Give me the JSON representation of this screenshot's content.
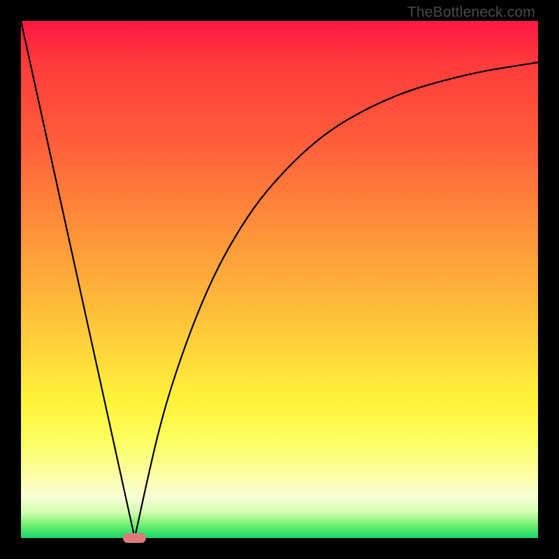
{
  "watermark_text": "TheBottleneck.com",
  "chart_data": {
    "type": "line",
    "title": "",
    "xlabel": "",
    "ylabel": "",
    "xlim": [
      0,
      100
    ],
    "ylim": [
      0,
      100
    ],
    "grid": false,
    "legend": false,
    "series": [
      {
        "name": "left-linear-descent",
        "x": [
          0,
          22
        ],
        "y": [
          100,
          0
        ]
      },
      {
        "name": "right-saturating-curve",
        "x": [
          22,
          25,
          28,
          32,
          36,
          40,
          45,
          50,
          55,
          60,
          65,
          70,
          75,
          80,
          85,
          90,
          95,
          100
        ],
        "y": [
          0,
          14,
          26,
          38,
          48,
          56,
          64,
          70,
          75,
          79,
          82,
          84.5,
          86.5,
          88,
          89.3,
          90.4,
          91.2,
          92
        ]
      }
    ],
    "marker": {
      "name": "optimal-point",
      "cx": 22,
      "cy": 0,
      "width_pct": 4.5,
      "height_pct": 1.8,
      "color": "#e07a7a"
    },
    "background_gradient": {
      "type": "vertical",
      "stops": [
        {
          "pos": 0.0,
          "color": "#ff1744"
        },
        {
          "pos": 0.38,
          "color": "#ff8a3a"
        },
        {
          "pos": 0.74,
          "color": "#fff43a"
        },
        {
          "pos": 0.92,
          "color": "#f7ffd6"
        },
        {
          "pos": 1.0,
          "color": "#16d66b"
        }
      ]
    }
  }
}
